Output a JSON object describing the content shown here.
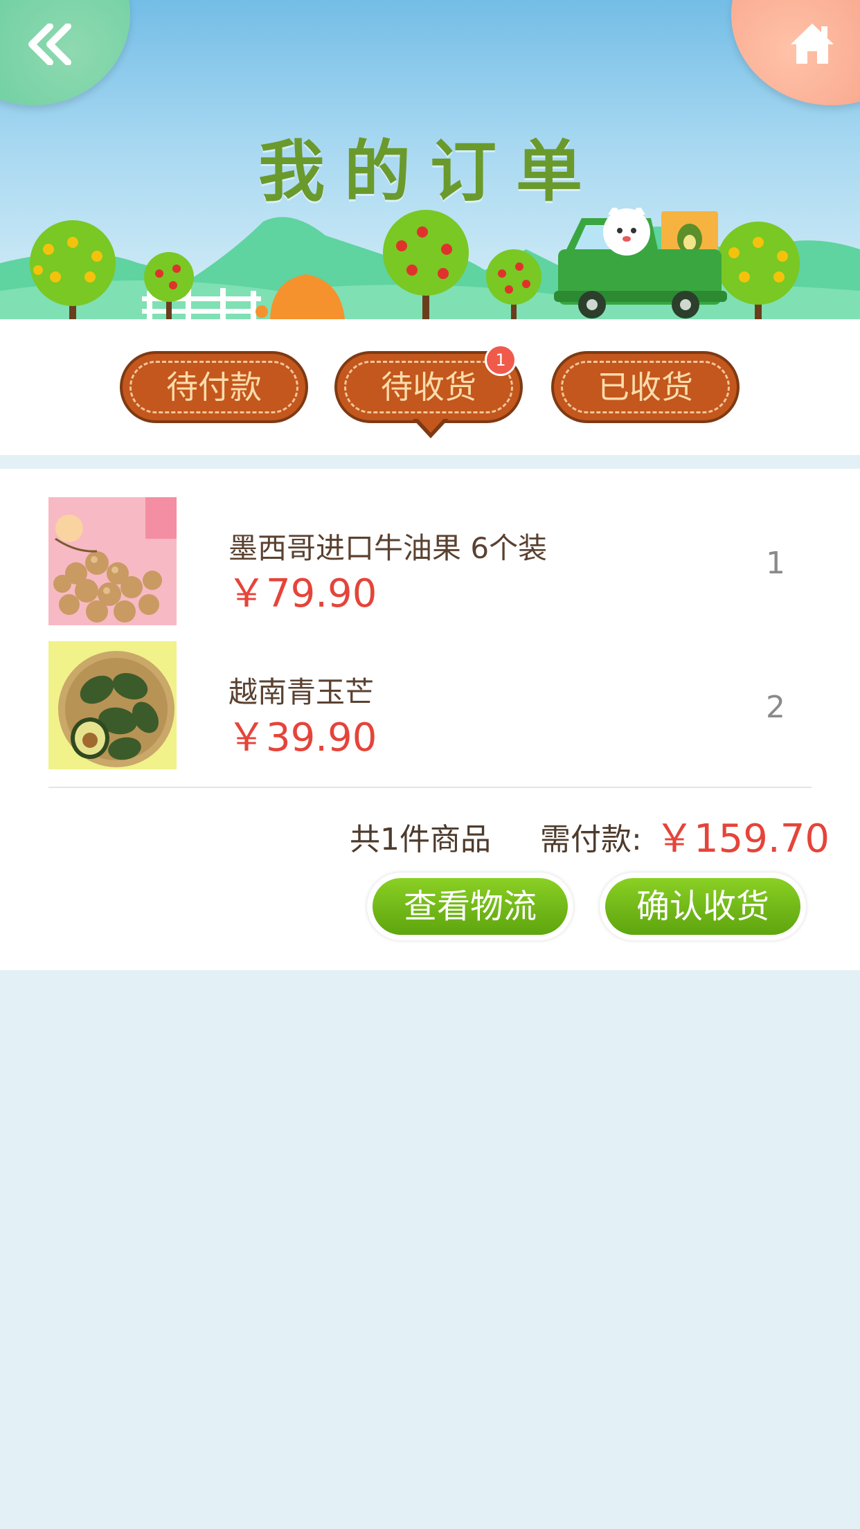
{
  "header": {
    "title": "我的订单",
    "back_icon": "double-chevron-left-icon",
    "home_icon": "home-icon"
  },
  "tabs": [
    {
      "label": "待付款",
      "active": false
    },
    {
      "label": "待收货",
      "active": true,
      "badge": "1"
    },
    {
      "label": "已收货",
      "active": false
    }
  ],
  "order": {
    "items": [
      {
        "name": "墨西哥进口牛油果 6个装",
        "price": "￥79.90",
        "quantity": "1"
      },
      {
        "name": "越南青玉芒",
        "price": "￥39.90",
        "quantity": "2"
      }
    ],
    "summary": {
      "count_text": "共1件商品",
      "pay_label": "需付款:",
      "total": "￥159.70"
    },
    "actions": {
      "logistics_label": "查看物流",
      "confirm_label": "确认收货"
    }
  },
  "colors": {
    "tab_fill": "#c3571d",
    "tab_text": "#fbdcab",
    "price": "#e5443a",
    "button_green": "#6fb517",
    "page_bg": "#e3f1f6"
  }
}
